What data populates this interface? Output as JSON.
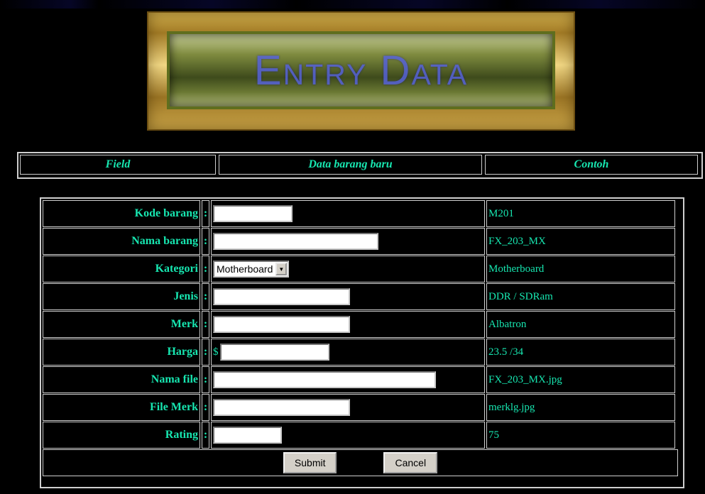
{
  "banner": {
    "title": "Entry Data"
  },
  "header": {
    "field": "Field",
    "data": "Data barang baru",
    "example": "Contoh"
  },
  "colon": ":",
  "currency": "$",
  "rows": [
    {
      "label": "Kode barang",
      "example": "M201",
      "value": ""
    },
    {
      "label": "Nama barang",
      "example": "FX_203_MX",
      "value": ""
    },
    {
      "label": "Kategori",
      "example": "Motherboard",
      "selected": "Motherboard"
    },
    {
      "label": "Jenis",
      "example": "DDR / SDRam",
      "value": ""
    },
    {
      "label": "Merk",
      "example": "Albatron",
      "value": ""
    },
    {
      "label": "Harga",
      "example": "23.5 /34",
      "value": ""
    },
    {
      "label": "Nama file",
      "example": "FX_203_MX.jpg",
      "value": ""
    },
    {
      "label": "File Merk",
      "example": "merklg.jpg",
      "value": ""
    },
    {
      "label": "Rating",
      "example": "75",
      "value": ""
    }
  ],
  "buttons": {
    "submit": "Submit",
    "cancel": "Cancel"
  },
  "colors": {
    "text": "#17e6b0",
    "background": "#000000",
    "border": "#cfcfcf"
  }
}
